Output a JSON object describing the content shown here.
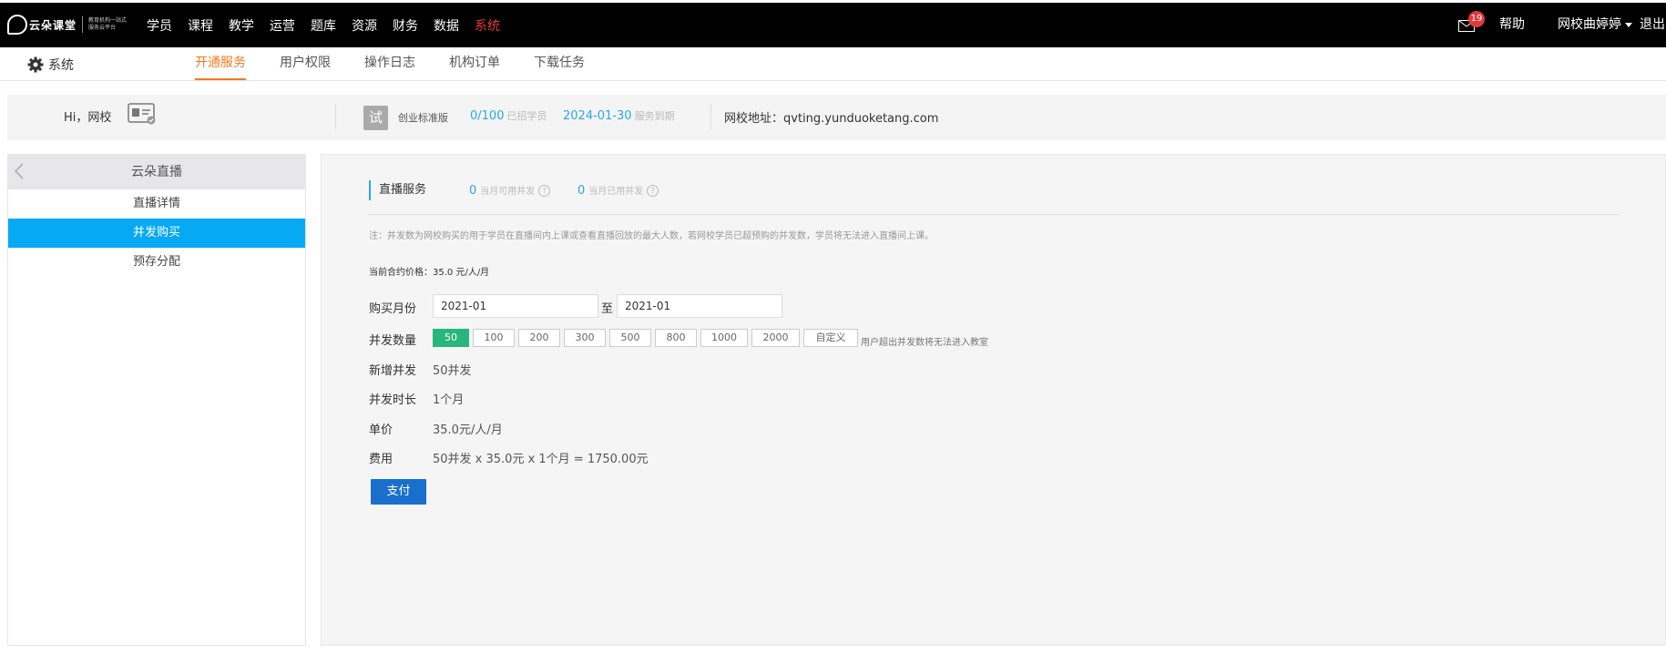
{
  "topbar": {
    "logo_text": "云朵课堂",
    "logo_slogan": "教育机构一站式服务云平台",
    "nav": [
      "学员",
      "课程",
      "教学",
      "运营",
      "题库",
      "资源",
      "财务",
      "数据",
      "系统"
    ],
    "active_nav": "系统",
    "mail_badge": "19",
    "help": "帮助",
    "user": "网校曲婷婷",
    "logout": "退出"
  },
  "subnav": {
    "title": "系统",
    "tabs": [
      "开通服务",
      "用户权限",
      "操作日志",
      "机构订单",
      "下载任务"
    ],
    "active_tab": "开通服务"
  },
  "info": {
    "greeting": "Hi，网校",
    "trial_badge": "试",
    "edition": "创业标准版",
    "students": "0/100",
    "students_label": "已招学员",
    "expire_date": "2024-01-30",
    "expire_label": "服务到期",
    "school_url": "网校地址：qvting.yunduoketang.com"
  },
  "sidebar": {
    "header": "云朵直播",
    "items": [
      "直播详情",
      "并发购买",
      "预存分配"
    ],
    "active_item": "并发购买"
  },
  "main": {
    "section_title": "直播服务",
    "available": {
      "value": "0",
      "label": "当月可用并发"
    },
    "used": {
      "value": "0",
      "label": "当月已用并发"
    },
    "note": "注：并发数为网校购买的用于学员在直播间内上课或查看直播回放的最大人数，若网校学员已超预购的并发数，学员将无法进入直播间上课。",
    "price": "当前合约价格：35.0 元/人/月",
    "month_label": "购买月份",
    "month_from": "2021-01",
    "to_label": "至",
    "month_to": "2021-01",
    "qty_label": "并发数量",
    "qty_options": [
      "50",
      "100",
      "200",
      "300",
      "500",
      "800",
      "1000",
      "2000",
      "自定义"
    ],
    "qty_selected": "50",
    "qty_hint": "用户超出并发数将无法进入教室",
    "added_label": "新增并发",
    "added_value": "50并发",
    "duration_label": "并发时长",
    "duration_value": "1个月",
    "unit_label": "单价",
    "unit_value": "35.0元/人/月",
    "fee_label": "费用",
    "fee_value": "50并发 x 35.0元 x 1个月 = 1750.00元",
    "pay_button": "支付"
  },
  "colors": {
    "topbar_bg": "#000000",
    "active_nav": "#e4393c",
    "accent_orange": "#f07c23",
    "accent_blue": "#2aa9e0",
    "sidebar_active": "#05a9f4",
    "qty_selected": "#27b67e",
    "pay_button": "#1a6fcc"
  }
}
